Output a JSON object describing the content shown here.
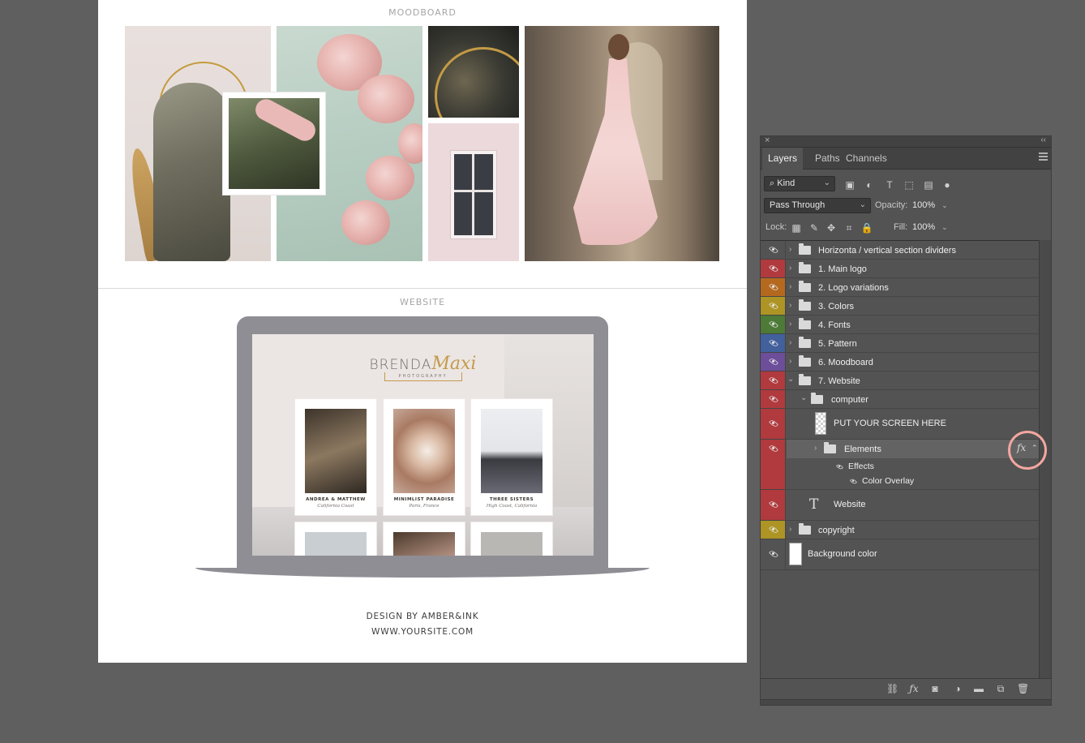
{
  "document": {
    "moodboard_label": "MOODBOARD",
    "website_label": "WEBSITE",
    "brand": {
      "first": "BRENDA",
      "script": "Maxi",
      "sub": "PHOTOGRAPHY"
    },
    "cards": [
      {
        "title": "ANDREA & MATTHEW",
        "subtitle": "California Coast",
        "img_color": "#6b6154"
      },
      {
        "title": "MINIMLIST PARADISE",
        "subtitle": "Paris, France",
        "img_color": "#c9a48e"
      },
      {
        "title": "THREE SISTERS",
        "subtitle": "High Coast, California",
        "img_color": "#8f8f95"
      }
    ],
    "footer_line1": "DESIGN BY AMBER&INK",
    "footer_line2": "WWW.YOURSITE.COM"
  },
  "panel": {
    "close_glyph": "×",
    "collapse_glyph": "‹‹",
    "tabs": [
      "Layers",
      "Paths",
      "Channels"
    ],
    "active_tab": "Layers",
    "filter_kind": "Kind",
    "blend_mode": "Pass Through",
    "opacity_label": "Opacity:",
    "opacity_value": "100%",
    "lock_label": "Lock:",
    "fill_label": "Fill:",
    "fill_value": "100%",
    "layers": [
      {
        "name": "Horizonta / vertical section dividers",
        "color": "#535353",
        "kind": "group"
      },
      {
        "name": "1. Main logo",
        "color": "#b03a3d",
        "kind": "group"
      },
      {
        "name": "2. Logo variations",
        "color": "#b5691f",
        "kind": "group"
      },
      {
        "name": "3. Colors",
        "color": "#ad9424",
        "kind": "group"
      },
      {
        "name": "4. Fonts",
        "color": "#4d7a36",
        "kind": "group"
      },
      {
        "name": "5. Pattern",
        "color": "#41609c",
        "kind": "group"
      },
      {
        "name": "6. Moodboard",
        "color": "#6d4e9a",
        "kind": "group"
      },
      {
        "name": "7. Website",
        "color": "#b03a3d",
        "kind": "group-open"
      },
      {
        "name": "computer",
        "color": "#b03a3d",
        "kind": "group-open"
      },
      {
        "name": "PUT YOUR SCREEN HERE",
        "color": "#b03a3d",
        "kind": "smart"
      },
      {
        "name": "Elements",
        "color": "#b03a3d",
        "kind": "group-fx"
      },
      {
        "name": "Website",
        "color": "#b03a3d",
        "kind": "text"
      },
      {
        "name": "copyright",
        "color": "#ad9424",
        "kind": "group"
      },
      {
        "name": "Background color",
        "color": "#535353",
        "kind": "fill"
      }
    ],
    "effects_label": "Effects",
    "color_overlay_label": "Color Overlay",
    "fx_glyph": "fx",
    "t_glyph": "T"
  }
}
